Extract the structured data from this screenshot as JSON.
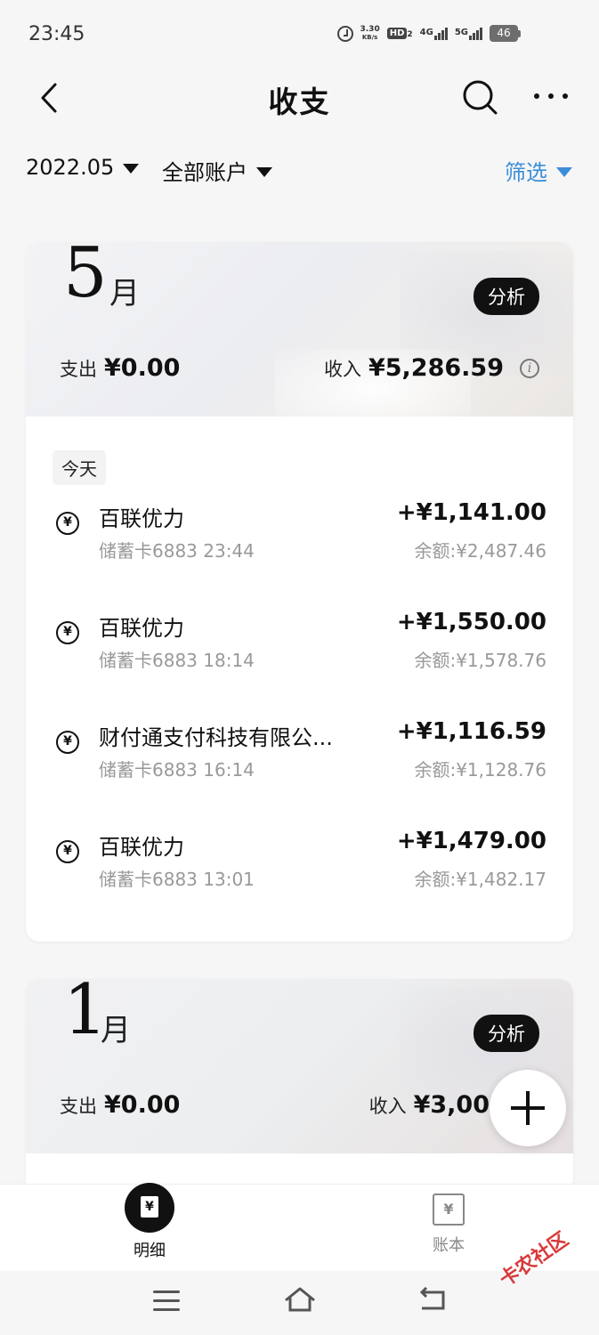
{
  "status_bar": {
    "time": "23:45",
    "net_speed_value": "3.30",
    "net_speed_unit": "KB/s",
    "hd_label": "HD",
    "hd_sub": "2",
    "signal_1": "4G",
    "signal_2": "5G",
    "battery": "46"
  },
  "header": {
    "title": "收支"
  },
  "filters": {
    "month": "2022.05",
    "account": "全部账户",
    "screen": "筛选",
    "accent_color": "#3b8ed8"
  },
  "months": [
    {
      "num": "5",
      "unit": "月",
      "analyze_label": "分析",
      "expense_label": "支出",
      "expense_amount": "¥0.00",
      "income_label": "收入",
      "income_amount": "¥5,286.59",
      "info_icon": "i",
      "day_label": "今天",
      "transactions": [
        {
          "icon": "¥",
          "name": "百联优力",
          "sub": "储蓄卡6883 23:44",
          "amount": "+¥1,141.00",
          "balance": "余额:¥2,487.46"
        },
        {
          "icon": "¥",
          "name": "百联优力",
          "sub": "储蓄卡6883 18:14",
          "amount": "+¥1,550.00",
          "balance": "余额:¥1,578.76"
        },
        {
          "icon": "¥",
          "name": "财付通支付科技有限公...",
          "sub": "储蓄卡6883 16:14",
          "amount": "+¥1,116.59",
          "balance": "余额:¥1,128.76"
        },
        {
          "icon": "¥",
          "name": "百联优力",
          "sub": "储蓄卡6883 13:01",
          "amount": "+¥1,479.00",
          "balance": "余额:¥1,482.17"
        }
      ]
    },
    {
      "num": "1",
      "unit": "月",
      "analyze_label": "分析",
      "expense_label": "支出",
      "expense_amount": "¥0.00",
      "income_label": "收入",
      "income_amount": "¥3,00"
    }
  ],
  "tabs": {
    "detail_label": "明细",
    "detail_icon": "¥",
    "book_label": "账本",
    "book_icon": "¥"
  },
  "watermark": "卡农社区"
}
